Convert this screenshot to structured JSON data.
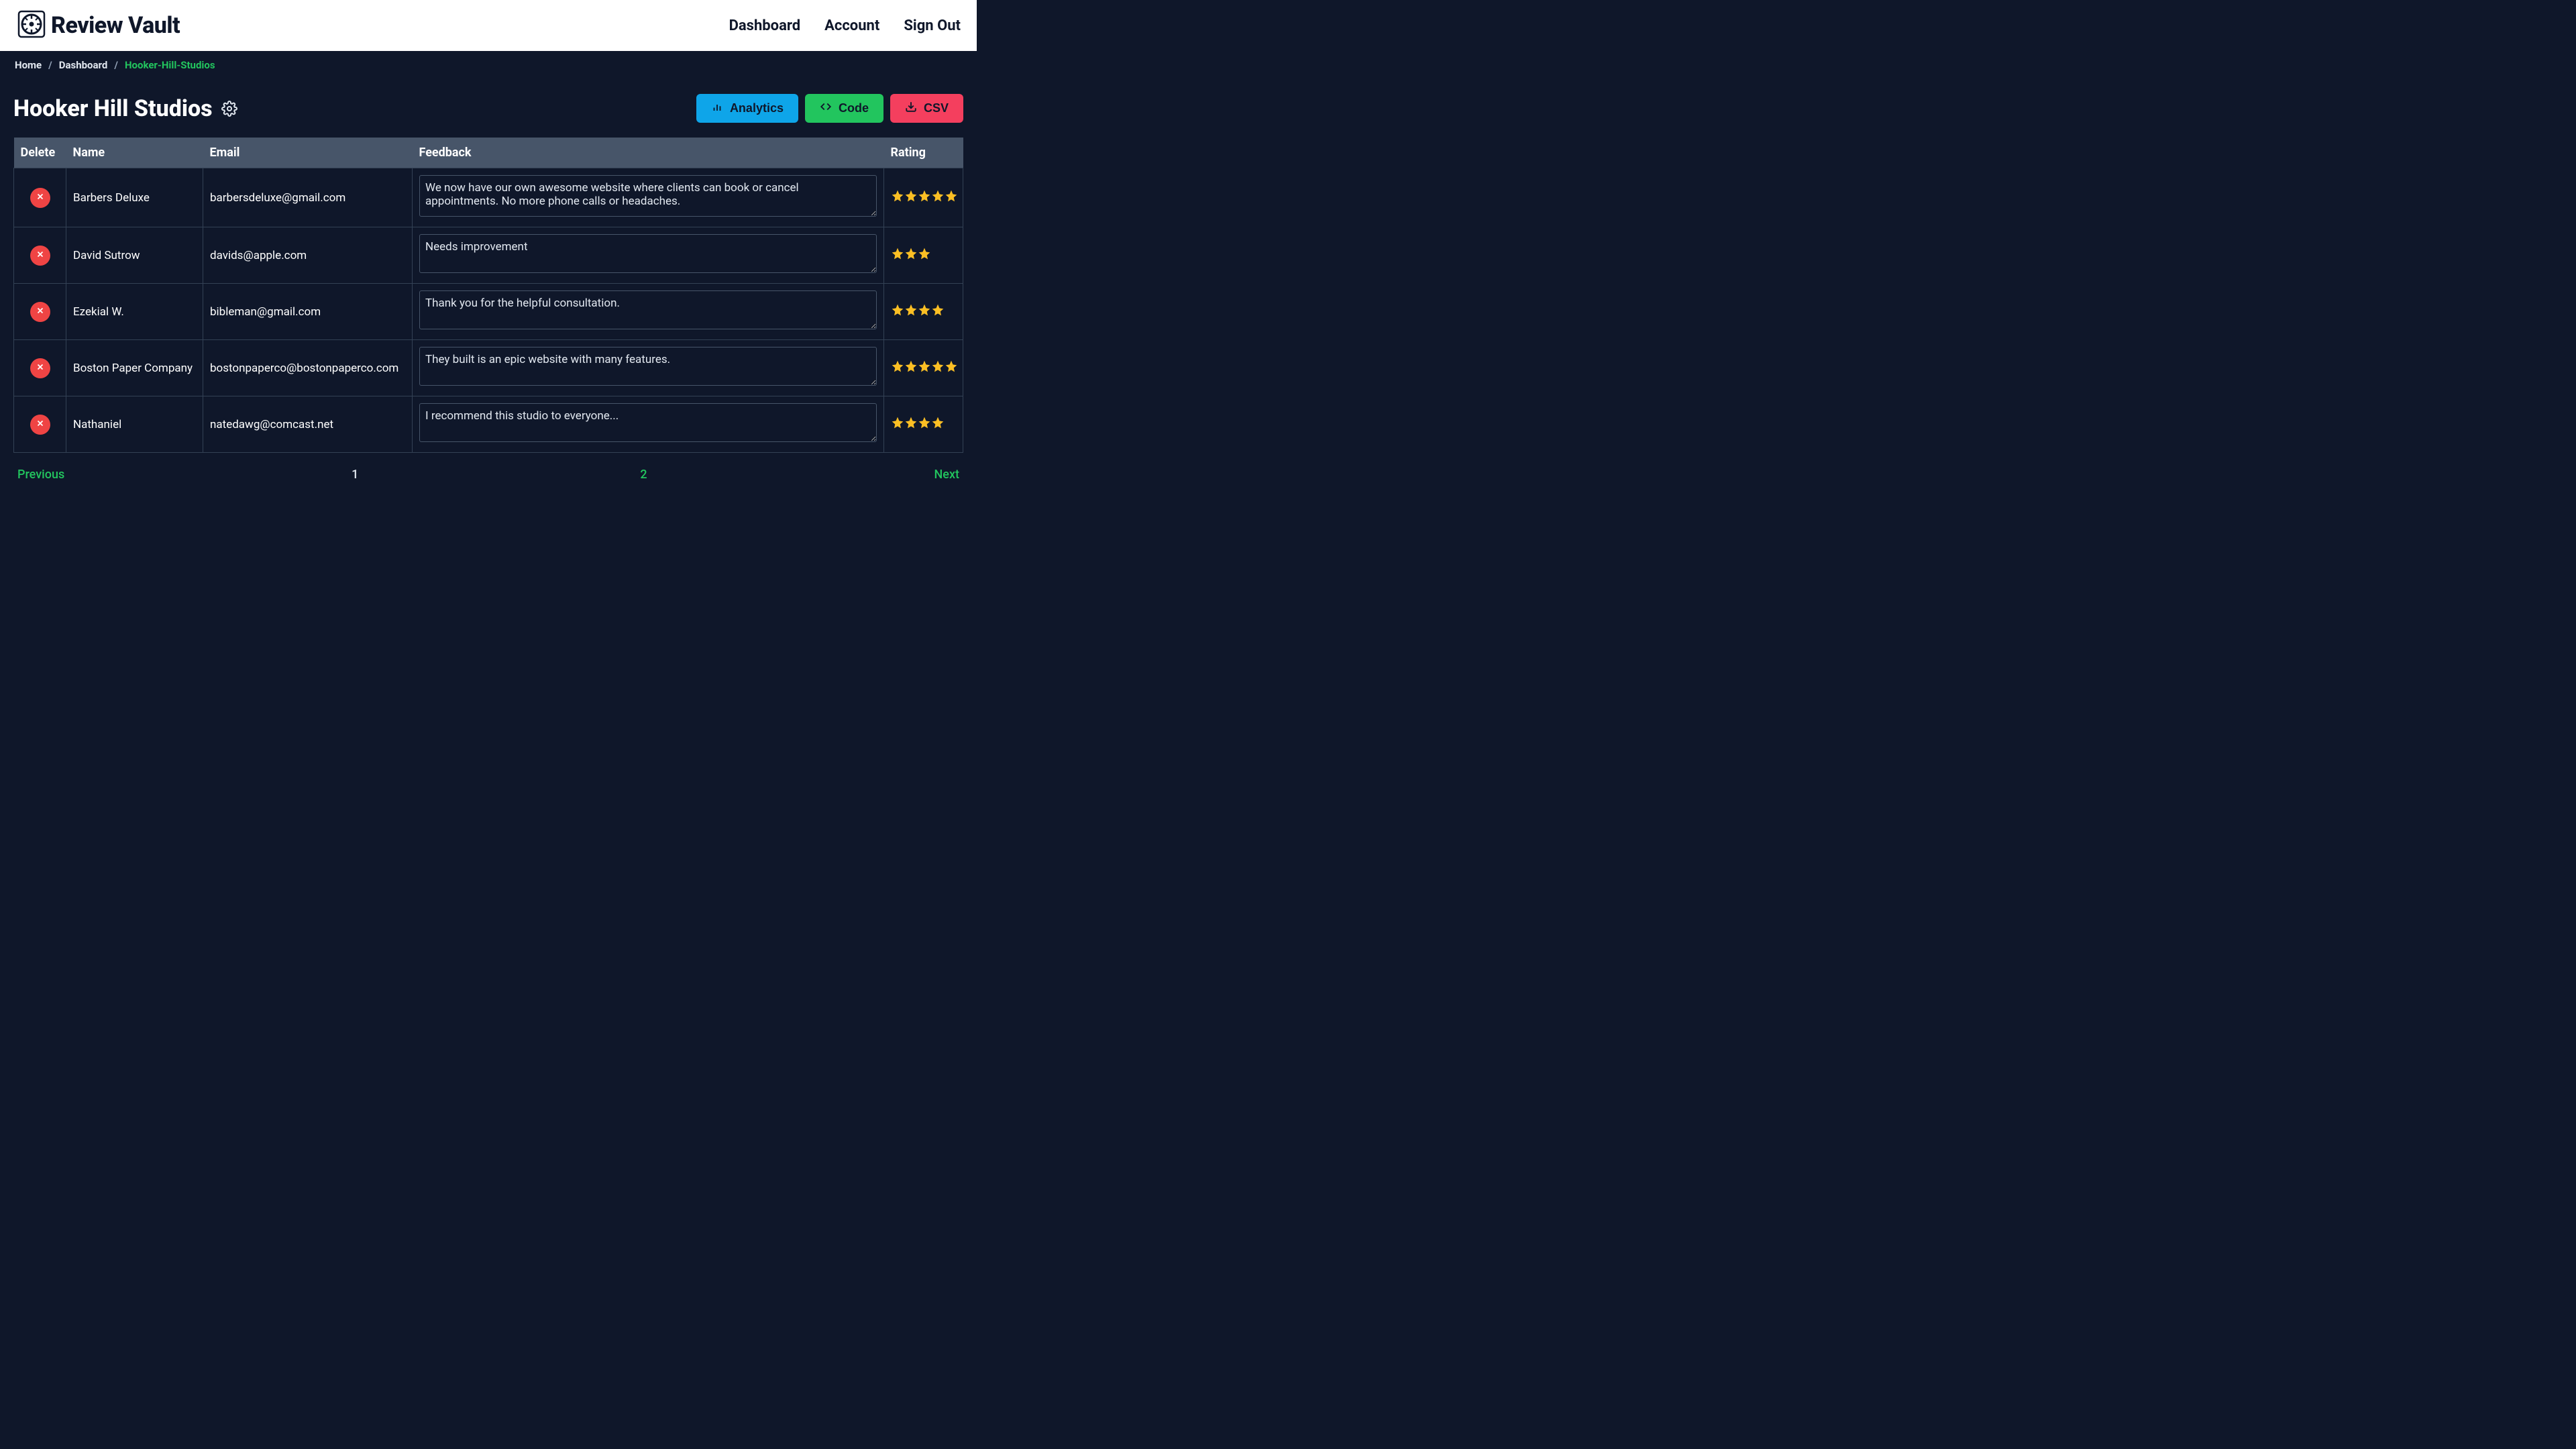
{
  "brand": {
    "name": "Review Vault"
  },
  "nav": {
    "dashboard": "Dashboard",
    "account": "Account",
    "signout": "Sign Out"
  },
  "breadcrumb": {
    "home": "Home",
    "dashboard": "Dashboard",
    "current": "Hooker-Hill-Studios"
  },
  "page": {
    "title": "Hooker Hill Studios"
  },
  "buttons": {
    "analytics": "Analytics",
    "code": "Code",
    "csv": "CSV"
  },
  "table": {
    "headers": {
      "delete": "Delete",
      "name": "Name",
      "email": "Email",
      "feedback": "Feedback",
      "rating": "Rating"
    },
    "rows": [
      {
        "name": "Barbers Deluxe",
        "email": "barbersdeluxe@gmail.com",
        "feedback": "We now have our own awesome website where clients can book or cancel appointments. No more phone calls or headaches.",
        "rating": 5
      },
      {
        "name": "David Sutrow",
        "email": "davids@apple.com",
        "feedback": "Needs improvement",
        "rating": 3
      },
      {
        "name": "Ezekial W.",
        "email": "bibleman@gmail.com",
        "feedback": "Thank you for the helpful consultation.",
        "rating": 4
      },
      {
        "name": "Boston Paper Company",
        "email": "bostonpaperco@bostonpaperco.com",
        "feedback": "They built is an epic website with many features.",
        "rating": 5
      },
      {
        "name": "Nathaniel",
        "email": "natedawg@comcast.net",
        "feedback": "I recommend this studio to everyone...",
        "rating": 4
      }
    ]
  },
  "pagination": {
    "previous": "Previous",
    "next": "Next",
    "pages": [
      "1",
      "2"
    ],
    "current_index": 0
  },
  "colors": {
    "accent_green": "#22c55e",
    "accent_blue": "#0ea5e9",
    "accent_pink": "#f43f5e",
    "star": "#fbbf24",
    "danger": "#ef4444"
  }
}
